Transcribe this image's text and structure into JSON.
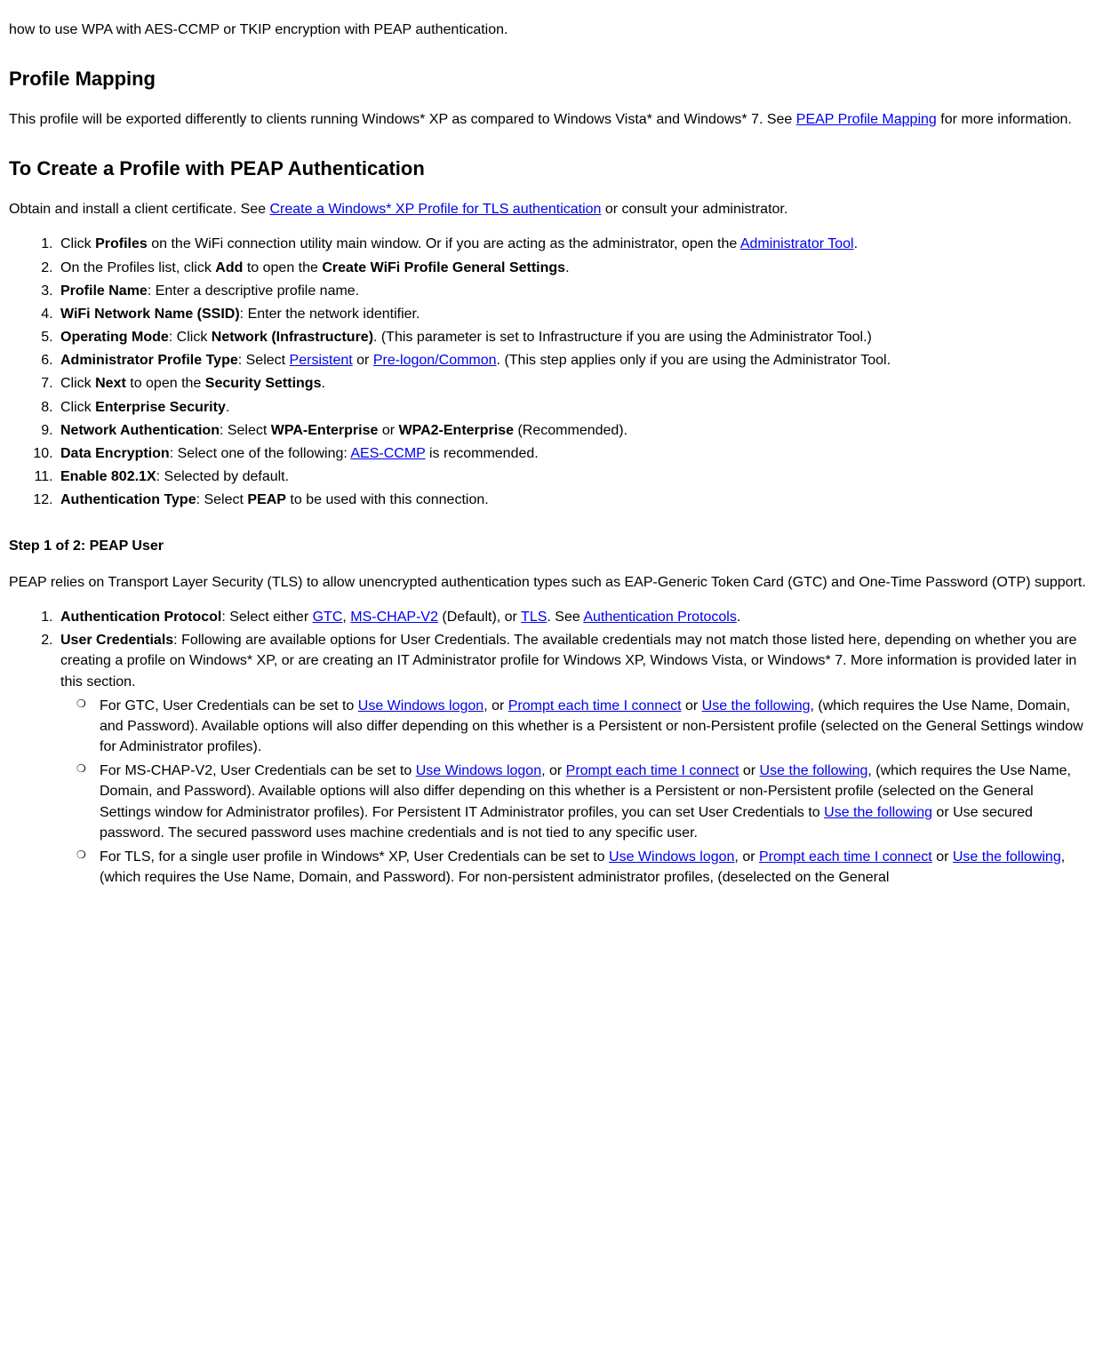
{
  "intro_line": "how to use WPA with AES-CCMP or TKIP encryption with PEAP authentication.",
  "h_profile_mapping": "Profile Mapping",
  "profile_mapping_pre": "This profile will be exported differently to clients running Windows* XP as compared to Windows Vista* and Windows* 7. See ",
  "profile_mapping_link": "PEAP Profile Mapping",
  "profile_mapping_post": " for more information.",
  "h_create_profile": "To Create a Profile with PEAP Authentication",
  "obtain_pre": "Obtain and install a client certificate. See ",
  "obtain_link": "Create a Windows* XP Profile for TLS authentication",
  "obtain_post": " or consult your administrator.",
  "li1_a": "Click ",
  "li1_b": "Profiles",
  "li1_c": " on the WiFi connection utility main window. Or if you are acting as the administrator, open the ",
  "li1_link": "Administrator Tool",
  "li1_d": ".",
  "li2_a": "On the Profiles list, click ",
  "li2_b": "Add",
  "li2_c": " to open the ",
  "li2_d": "Create WiFi Profile General Settings",
  "li2_e": ".",
  "li3_a": "Profile Name",
  "li3_b": ": Enter a descriptive profile name.",
  "li4_a": "WiFi Network Name (SSID)",
  "li4_b": ": Enter the network identifier.",
  "li5_a": "Operating Mode",
  "li5_b": ": Click ",
  "li5_c": "Network (Infrastructure)",
  "li5_d": ". (This parameter is set to Infrastructure if you are using the Administrator Tool.)",
  "li6_a": "Administrator Profile Type",
  "li6_b": ": Select ",
  "li6_link1": "Persistent",
  "li6_c": " or ",
  "li6_link2": "Pre-logon/Common",
  "li6_d": ". (This step applies only if you are using the Administrator Tool.",
  "li7_a": "Click ",
  "li7_b": "Next",
  "li7_c": " to open the ",
  "li7_d": "Security Settings",
  "li7_e": ".",
  "li8_a": "Click ",
  "li8_b": "Enterprise Security",
  "li8_c": ".",
  "li9_a": "Network Authentication",
  "li9_b": ": Select ",
  "li9_c": "WPA-Enterprise",
  "li9_d": " or ",
  "li9_e": "WPA2-Enterprise",
  "li9_f": " (Recommended).",
  "li10_a": "Data Encryption",
  "li10_b": ": Select one of the following: ",
  "li10_link": "AES-CCMP",
  "li10_c": " is recommended.",
  "li11_a": "Enable 802.1X",
  "li11_b": ": Selected by default.",
  "li12_a": "Authentication Type",
  "li12_b": ": Select ",
  "li12_c": "PEAP",
  "li12_d": " to be used with this connection.",
  "h_step1": "Step 1 of 2: PEAP User",
  "step1_intro": "PEAP relies on Transport Layer Security (TLS) to allow unencrypted authentication types such as EAP-Generic Token Card (GTC) and One-Time Password (OTP) support.",
  "s1_a": "Authentication Protocol",
  "s1_b": ": Select either ",
  "s1_link1": "GTC",
  "s1_c": ", ",
  "s1_link2": "MS-CHAP-V2",
  "s1_d": " (Default), or ",
  "s1_link3": "TLS",
  "s1_e": ". See ",
  "s1_link4": "Authentication Protocols",
  "s1_f": ".",
  "s2_a": "User Credentials",
  "s2_b": ": Following are available options for User Credentials. The available credentials may not match those listed here, depending on whether you are creating a profile on Windows* XP, or are creating an IT Administrator profile for Windows XP, Windows Vista, or Windows* 7. More information is provided later in this section.",
  "s2_c1_a": "For GTC, User Credentials can be set to ",
  "s2_c1_l1": "Use Windows logon",
  "s2_c1_b": ", or ",
  "s2_c1_l2": "Prompt each time I connect",
  "s2_c1_c": " or ",
  "s2_c1_l3": "Use the following",
  "s2_c1_d": ", (which requires the Use Name, Domain, and Password). Available options will also differ depending on this whether is a Persistent or non-Persistent profile (selected on the General Settings window for Administrator profiles).",
  "s2_c2_a": "For MS-CHAP-V2, User Credentials can be set to ",
  "s2_c2_l1": "Use Windows logon",
  "s2_c2_b": ", or ",
  "s2_c2_l2": "Prompt each time I connect",
  "s2_c2_c": " or ",
  "s2_c2_l3": "Use the following",
  "s2_c2_d": ", (which requires the Use Name, Domain, and Password). Available options will also differ depending on this whether is a Persistent or non-Persistent profile (selected on the General Settings window for Administrator profiles). For Persistent IT Administrator profiles, you can set User Credentials to ",
  "s2_c2_l4": "Use the following",
  "s2_c2_e": " or Use secured password. The secured password uses machine credentials and is not tied to any specific user.",
  "s2_c3_a": "For TLS, for a single user profile in Windows* XP, User Credentials can be set to ",
  "s2_c3_l1": "Use Windows logon",
  "s2_c3_b": ", or ",
  "s2_c3_l2": "Prompt each time I connect",
  "s2_c3_c": " or ",
  "s2_c3_l3": "Use the following",
  "s2_c3_d": ", (which requires the Use Name, Domain, and Password). For non-persistent administrator profiles, (deselected on the General"
}
